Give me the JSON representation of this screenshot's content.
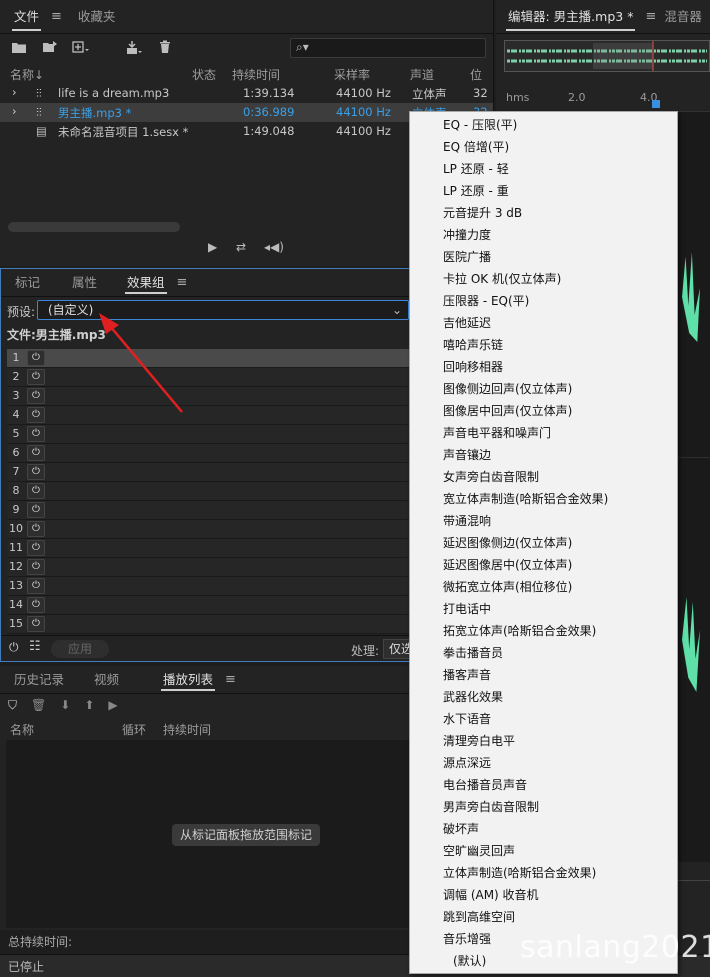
{
  "files_panel": {
    "tabs": [
      {
        "label": "文件",
        "active": true
      },
      {
        "label": "收藏夹",
        "active": false
      }
    ],
    "search_icon": "⌕▾",
    "columns": [
      "名称↓",
      "状态",
      "持续时间",
      "采样率",
      "声道",
      "位"
    ],
    "rows": [
      {
        "name": "life is a dream.mp3",
        "duration": "1:39.134",
        "rate": "44100 Hz",
        "channels": "立体声",
        "bits": "32"
      },
      {
        "name": "男主播.mp3 *",
        "duration": "0:36.989",
        "rate": "44100 Hz",
        "channels": "立体声",
        "bits": "32"
      },
      {
        "name": "未命名混音项目 1.sesx *",
        "duration": "1:49.048",
        "rate": "44100 Hz",
        "channels": "",
        "bits": ""
      }
    ]
  },
  "editor": {
    "tabs": [
      {
        "label": "编辑器: 男主播.mp3 *",
        "active": true
      },
      {
        "label": "混音器",
        "active": false
      }
    ],
    "ruler": [
      "hms",
      "2.0",
      "4.0"
    ]
  },
  "effects_panel": {
    "tabs": [
      {
        "label": "标记",
        "active": false
      },
      {
        "label": "属性",
        "active": false
      },
      {
        "label": "效果组",
        "active": true
      }
    ],
    "preset_label": "预设:",
    "preset_value": "(自定义)",
    "file_label": "文件:男主播.mp3",
    "rack_numbers": [
      "1",
      "2",
      "3",
      "4",
      "5",
      "6",
      "7",
      "8",
      "9",
      "10",
      "11",
      "12",
      "13",
      "14",
      "15"
    ],
    "apply_label": "应用",
    "process_label": "处理:",
    "process_value": "仅选区"
  },
  "playlist_panel": {
    "tabs": [
      {
        "label": "历史记录",
        "active": false
      },
      {
        "label": "视频",
        "active": false
      },
      {
        "label": "播放列表",
        "active": true
      }
    ],
    "columns": [
      "名称",
      "循环",
      "持续时间"
    ],
    "hint": "从标记面板拖放范围标记"
  },
  "status": {
    "total_duration_label": "总持续时间:",
    "state": "已停止"
  },
  "dropdown": {
    "items": [
      "EQ - 压限(平)",
      "EQ 倍增(平)",
      "LP 还原 - 轻",
      "LP 还原 - 重",
      "元音提升 3 dB",
      "冲撞力度",
      "医院广播",
      "卡拉 OK 机(仅立体声)",
      "压限器 - EQ(平)",
      "吉他延迟",
      "嘻哈声乐链",
      "回响移相器",
      "图像侧边回声(仅立体声)",
      "图像居中回声(仅立体声)",
      "声音电平器和噪声门",
      "声音镶边",
      "女声旁白齿音限制",
      "宽立体声制造(哈斯铝合金效果)",
      "带通混响",
      "延迟图像侧边(仅立体声)",
      "延迟图像居中(仅立体声)",
      "微拓宽立体声(相位移位)",
      "打电话中",
      "拓宽立体声(哈斯铝合金效果)",
      "拳击播音员",
      "播客声音",
      "武器化效果",
      "水下语音",
      "清理旁白电平",
      "源点深远",
      "电台播音员声音",
      "男声旁白齿音限制",
      "破坏声",
      "空旷幽灵回声",
      "立体声制造(哈斯铝合金效果)",
      "调幅 (AM) 收音机",
      "跳到高维空间",
      "音乐增强",
      "(默认)"
    ]
  },
  "watermark": "sanlang2021",
  "colors": {
    "accent": "#3aa0e8",
    "waveform": "#5ee0a8",
    "arrow": "#e02020",
    "focus_border": "#3b86d6"
  }
}
